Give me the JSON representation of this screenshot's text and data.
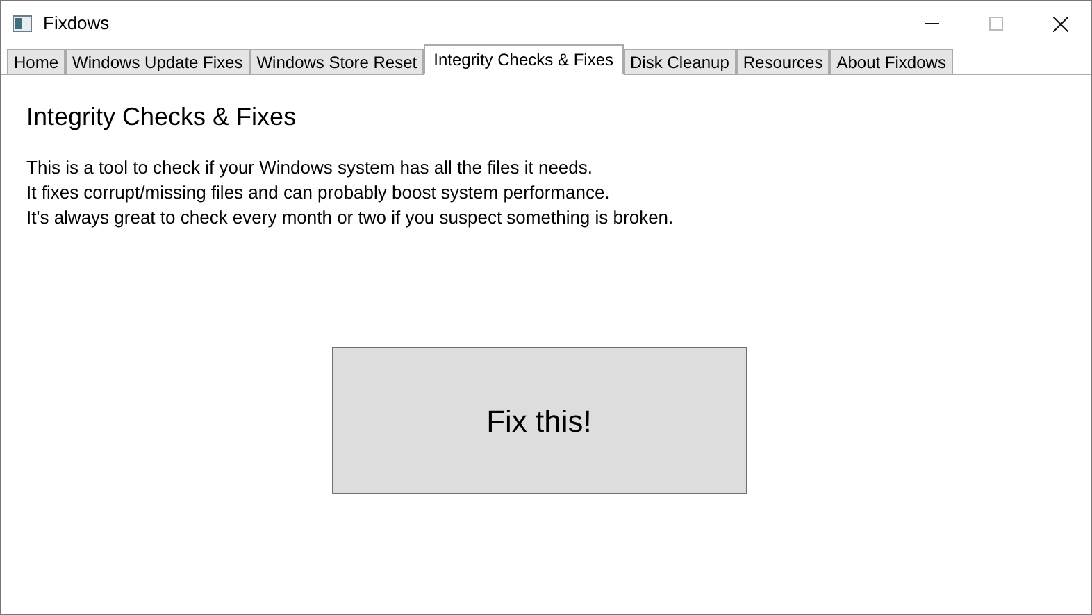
{
  "window": {
    "title": "Fixdows"
  },
  "tabs": [
    {
      "label": "Home",
      "selected": false
    },
    {
      "label": "Windows Update Fixes",
      "selected": false
    },
    {
      "label": "Windows Store Reset",
      "selected": false
    },
    {
      "label": "Integrity Checks & Fixes",
      "selected": true
    },
    {
      "label": "Disk Cleanup",
      "selected": false
    },
    {
      "label": "Resources",
      "selected": false
    },
    {
      "label": "About Fixdows",
      "selected": false
    }
  ],
  "page": {
    "heading": "Integrity Checks & Fixes",
    "description": [
      "This is a tool to check if your Windows system has all the files it needs.",
      "It fixes corrupt/missing files and can probably boost system performance.",
      "It's always great to check every month or two if you suspect something is broken."
    ],
    "button": "Fix this!"
  }
}
